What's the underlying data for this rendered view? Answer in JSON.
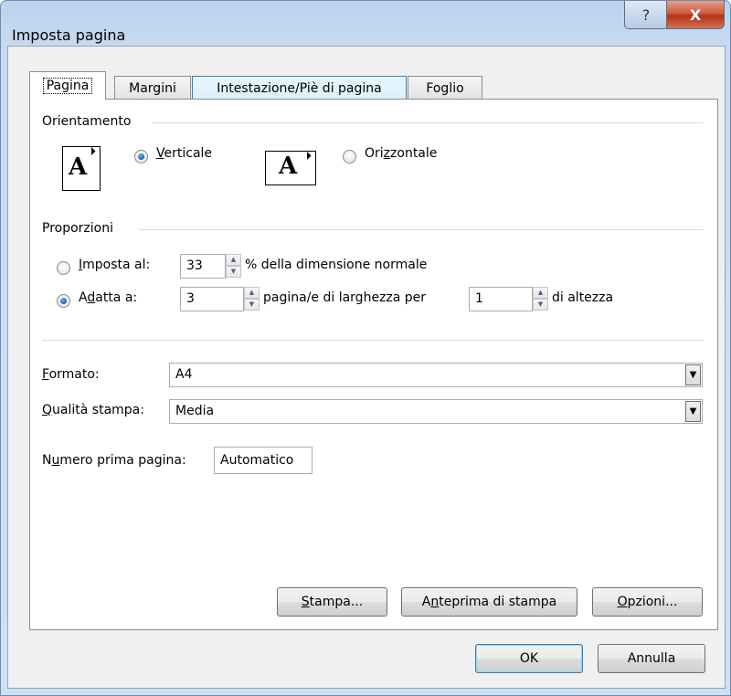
{
  "window": {
    "title": "Imposta pagina",
    "help_glyph": "?",
    "close_glyph": "X"
  },
  "tabs": [
    {
      "label": "Pagina",
      "active": true
    },
    {
      "label": "Margini"
    },
    {
      "label": "Intestazione/Piè di pagina"
    },
    {
      "label": "Foglio"
    }
  ],
  "orientation": {
    "group_label": "Orientamento",
    "icon_letter": "A",
    "portrait": {
      "label_u": "V",
      "label_rest": "erticale",
      "checked": true
    },
    "landscape": {
      "label_pre": "Ori",
      "label_u": "z",
      "label_rest": "zontale",
      "checked": false
    }
  },
  "scaling": {
    "group_label": "Proporzioni",
    "set_to": {
      "label_u": "I",
      "label_rest": "mposta al:",
      "value": "33",
      "suffix": "% della dimensione normale",
      "checked": false
    },
    "fit_to": {
      "label_pre": "A",
      "label_u": "d",
      "label_rest": "atta a:",
      "pages_wide": "3",
      "middle": "pagina/e di larghezza per",
      "pages_tall": "1",
      "suffix": "di altezza",
      "checked": true
    }
  },
  "paper": {
    "label_u": "F",
    "label_rest": "ormato:",
    "value": "A4"
  },
  "quality": {
    "label_u": "Q",
    "label_rest": "ualità stampa:",
    "value": "Media"
  },
  "first_page": {
    "label_pre": "N",
    "label_u": "u",
    "label_rest": "mero prima pagina:",
    "value": "Automatico"
  },
  "panel_buttons": {
    "print": {
      "u": "S",
      "rest": "tampa..."
    },
    "preview": {
      "pre": "A",
      "u": "n",
      "rest": "teprima di stampa"
    },
    "options": {
      "u": "O",
      "rest": "pzioni..."
    }
  },
  "dialog_buttons": {
    "ok": "OK",
    "cancel": "Annulla"
  },
  "colors": {
    "titlebar": "#c8dbf1",
    "close_button": "#c4472a",
    "radio_checked": "#1b62b7",
    "tab_hover": "#d9f0fc"
  }
}
